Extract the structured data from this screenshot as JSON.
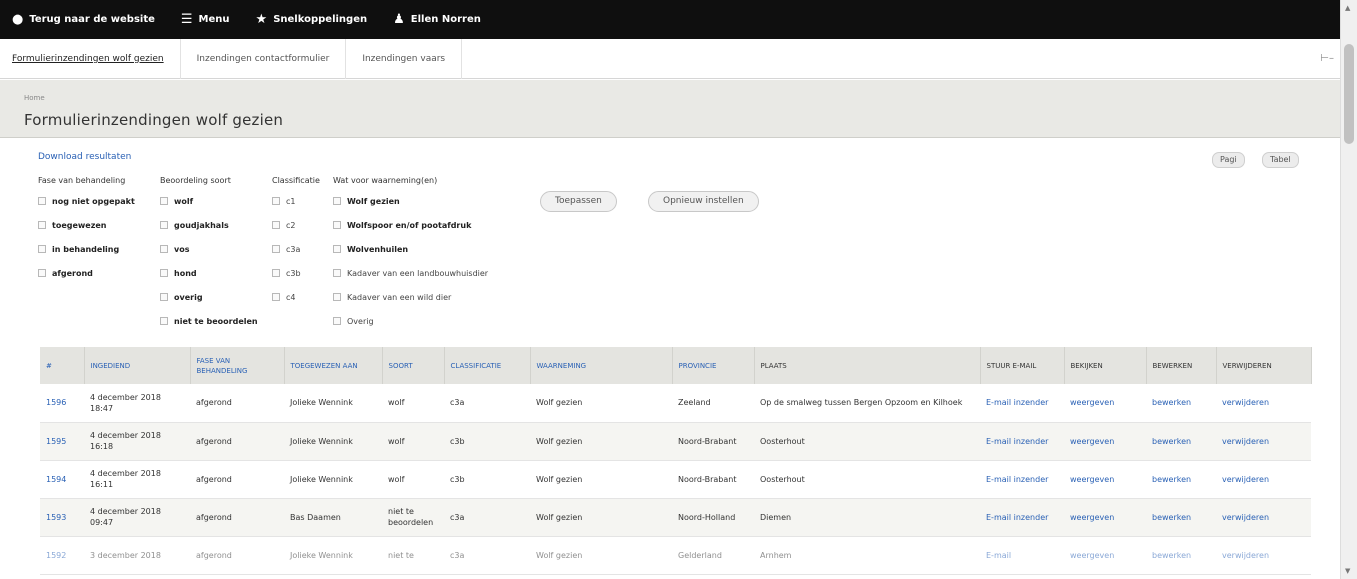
{
  "toolbar": {
    "items": [
      {
        "icon": "drupal-icon",
        "label": "Terug naar de website"
      },
      {
        "icon": "menu-icon",
        "label": "Menu"
      },
      {
        "icon": "star-icon",
        "label": "Snelkoppelingen"
      },
      {
        "icon": "user-icon",
        "label": "Ellen Norren"
      }
    ]
  },
  "tray": {
    "tabs": [
      "Formulierinzendingen wolf gezien",
      "Inzendingen contactformulier",
      "Inzendingen vaars"
    ]
  },
  "header": {
    "breadcrumb": "Home",
    "title": "Formulierinzendingen wolf gezien"
  },
  "filters": {
    "download_label": "Download resultaten",
    "top_buttons": [
      "Pagi",
      "Tabel"
    ],
    "columns": [
      {
        "label": "Fase van behandeling",
        "options": [
          "nog niet opgepakt",
          "toegewezen",
          "in behandeling",
          "afgerond"
        ]
      },
      {
        "label": "Beoordeling soort",
        "options": [
          "wolf",
          "goudjakhals",
          "vos",
          "hond",
          "overig",
          "niet te beoordelen"
        ]
      },
      {
        "label": "Classificatie",
        "options": [
          "c1",
          "c2",
          "c3a",
          "c3b",
          "c4"
        ]
      },
      {
        "label": "Wat voor waarneming(en)",
        "options": [
          "Wolf gezien",
          "Wolfspoor en/of pootafdruk",
          "Wolvenhuilen",
          "Kadaver van een landbouwhuisdier",
          "Kadaver van een wild dier",
          "Overig"
        ]
      }
    ],
    "apply_label": "Toepassen",
    "reset_label": "Opnieuw instellen"
  },
  "table": {
    "headers": [
      "#",
      "INGEDIEND",
      "FASE VAN BEHANDELING",
      "TOEGEWEZEN AAN",
      "SOORT",
      "CLASSIFICATIE",
      "WAARNEMING",
      "PROVINCIE",
      "PLAATS",
      "STUUR E-MAIL",
      "BEKIJKEN",
      "BEWERKEN",
      "VERWIJDEREN"
    ],
    "rows": [
      {
        "id": "1596",
        "date": "4 december 2018 18:47",
        "phase": "afgerond",
        "assigned": "Jolieke Wennink",
        "species": "wolf",
        "class": "c3a",
        "obs": "Wolf gezien",
        "province": "Zeeland",
        "place": "Op de smalweg tussen Bergen Opzoom en Kilhoek",
        "email": "E-mail inzender",
        "view": "weergeven",
        "edit": "bewerken",
        "del": "verwijderen"
      },
      {
        "id": "1595",
        "date": "4 december 2018 16:18",
        "phase": "afgerond",
        "assigned": "Jolieke Wennink",
        "species": "wolf",
        "class": "c3b",
        "obs": "Wolf gezien",
        "province": "Noord-Brabant",
        "place": "Oosterhout",
        "email": "E-mail inzender",
        "view": "weergeven",
        "edit": "bewerken",
        "del": "verwijderen"
      },
      {
        "id": "1594",
        "date": "4 december 2018 16:11",
        "phase": "afgerond",
        "assigned": "Jolieke Wennink",
        "species": "wolf",
        "class": "c3b",
        "obs": "Wolf gezien",
        "province": "Noord-Brabant",
        "place": "Oosterhout",
        "email": "E-mail inzender",
        "view": "weergeven",
        "edit": "bewerken",
        "del": "verwijderen"
      },
      {
        "id": "1593",
        "date": "4 december 2018 09:47",
        "phase": "afgerond",
        "assigned": "Bas Daamen",
        "species": "niet te beoordelen",
        "class": "c3a",
        "obs": "Wolf gezien",
        "province": "Noord-Holland",
        "place": "Diemen",
        "email": "E-mail inzender",
        "view": "weergeven",
        "edit": "bewerken",
        "del": "verwijderen"
      },
      {
        "id": "1592",
        "date": "3 december 2018",
        "phase": "afgerond",
        "assigned": "Jolieke Wennink",
        "species": "niet te",
        "class": "c3a",
        "obs": "Wolf gezien",
        "province": "Gelderland",
        "place": "Arnhem",
        "email": "E-mail",
        "view": "weergeven",
        "edit": "bewerken",
        "del": "verwijderen"
      }
    ]
  }
}
